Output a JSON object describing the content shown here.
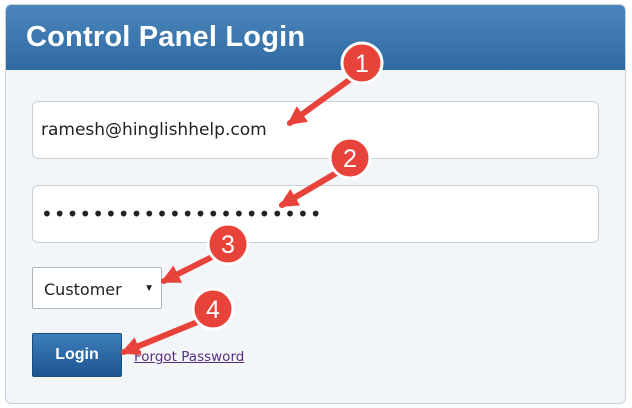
{
  "header": {
    "title": "Control Panel Login"
  },
  "form": {
    "email_value": "ramesh@hinglishhelp.com",
    "password_mask": "••••••••••••••••••••••",
    "role_selected": "Customer",
    "login_label": "Login",
    "forgot_label": "Forgot Password"
  },
  "annotations": [
    {
      "label": "1"
    },
    {
      "label": "2"
    },
    {
      "label": "3"
    },
    {
      "label": "4"
    }
  ],
  "colors": {
    "header": "#3874ad",
    "annotation": "#e8433a",
    "button": "#2b6aa6",
    "link": "#5a2d82"
  }
}
